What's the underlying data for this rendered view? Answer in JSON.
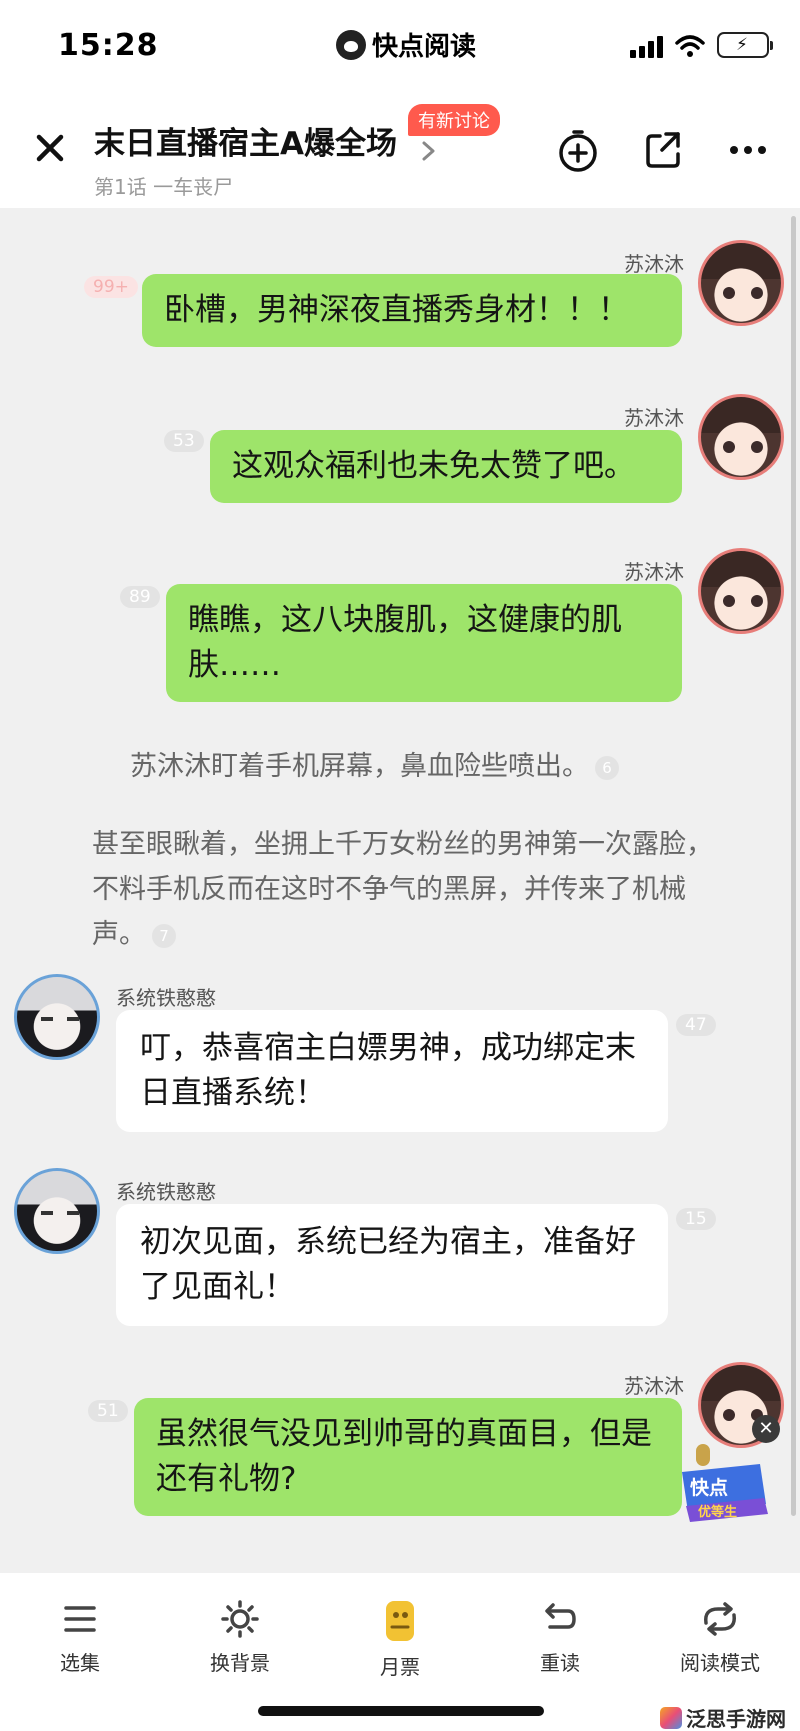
{
  "status_bar": {
    "time": "15:28",
    "app_name": "快点阅读"
  },
  "header": {
    "title": "末日直播宿主A爆全场",
    "subtitle": "第1话 一车丧尸",
    "discuss_badge": "有新讨论"
  },
  "messages": [
    {
      "sender": "苏沐沐",
      "side": "right",
      "text": "卧槽，男神深夜直播秀身材！！！",
      "count": "99+"
    },
    {
      "sender": "苏沐沐",
      "side": "right",
      "text": "这观众福利也未免太赞了吧。",
      "count": "53"
    },
    {
      "sender": "苏沐沐",
      "side": "right",
      "text": "瞧瞧，这八块腹肌，这健康的肌肤……",
      "count": "89"
    },
    {
      "type": "narration",
      "text": "苏沐沐盯着手机屏幕，鼻血险些喷出。",
      "count": "6"
    },
    {
      "type": "narration",
      "text": "甚至眼瞅着，坐拥上千万女粉丝的男神第一次露脸，不料手机反而在这时不争气的黑屏，并传来了机械声。",
      "count": "7"
    },
    {
      "sender": "系统铁憨憨",
      "side": "left",
      "text": "叮，恭喜宿主白嫖男神，成功绑定末日直播系统！",
      "count": "47"
    },
    {
      "sender": "系统铁憨憨",
      "side": "left",
      "text": "初次见面，系统已经为宿主，准备好了见面礼！",
      "count": "15"
    },
    {
      "sender": "苏沐沐",
      "side": "right",
      "text": "虽然很气没见到帅哥的真面目，但是还有礼物?",
      "count": "51"
    }
  ],
  "vip_badge": {
    "line1": "快点",
    "line2": "优等生"
  },
  "toolbar": [
    {
      "label": "选集",
      "icon": "list-icon"
    },
    {
      "label": "换背景",
      "icon": "sun-icon"
    },
    {
      "label": "月票",
      "icon": "ticket-icon"
    },
    {
      "label": "重读",
      "icon": "reread-icon"
    },
    {
      "label": "阅读模式",
      "icon": "mode-icon"
    }
  ],
  "watermark": "泛思手游网",
  "colors": {
    "green_bubble": "#9ee46a",
    "badge_red": "#ff5a4d",
    "chat_bg": "#f0f0f0"
  }
}
